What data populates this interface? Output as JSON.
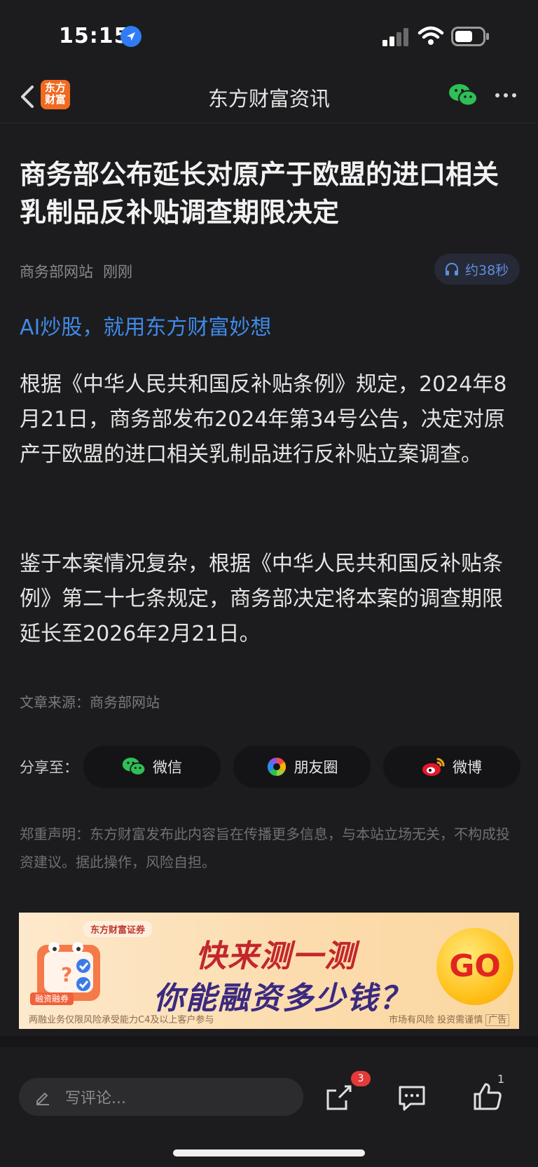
{
  "status_bar": {
    "time": "15:15"
  },
  "nav": {
    "title": "东方财富资讯",
    "logo_text": "东方财富"
  },
  "article": {
    "title": "商务部公布延长对原产于欧盟的进口相关乳制品反补贴调查期限决定",
    "source_name": "商务部网站",
    "time": "刚刚",
    "audio_duration": "约38秒",
    "promo_link": "AI炒股，就用东方财富妙想",
    "paragraphs": [
      "根据《中华人民共和国反补贴条例》规定，2024年8月21日，商务部发布2024年第34号公告，决定对原产于欧盟的进口相关乳制品进行反补贴立案调查。",
      "鉴于本案情况复杂，根据《中华人民共和国反补贴条例》第二十七条规定，商务部决定将本案的调查期限延长至2026年2月21日。"
    ],
    "source_line": "文章来源：商务部网站"
  },
  "share": {
    "label": "分享至：",
    "buttons": [
      {
        "label": "微信",
        "icon": "wechat-icon"
      },
      {
        "label": "朋友圈",
        "icon": "moments-icon"
      },
      {
        "label": "微博",
        "icon": "weibo-icon"
      }
    ]
  },
  "disclaimer": "郑重声明：东方财富发布此内容旨在传播更多信息，与本站立场无关，不构成投资建议。据此操作，风险自担。",
  "banner": {
    "brand": "东方财富证券",
    "headline1": "快来测一测",
    "headline2": "你能融资多少钱？",
    "cta": "GO",
    "footnote_left": "两融业务仅限风险承受能力C4及以上客户参与",
    "footnote_right": "市场有风险 投资需谨慎",
    "ad_tag": "广告",
    "icon_label": "融资融券"
  },
  "bottom_bar": {
    "comment_placeholder": "写评论...",
    "share_badge": "3",
    "like_count": "1"
  },
  "colors": {
    "background": "#1c1c1e",
    "link_blue": "#3f8ae8",
    "brand_orange": "#f06a20",
    "badge_red": "#e43a3a"
  }
}
